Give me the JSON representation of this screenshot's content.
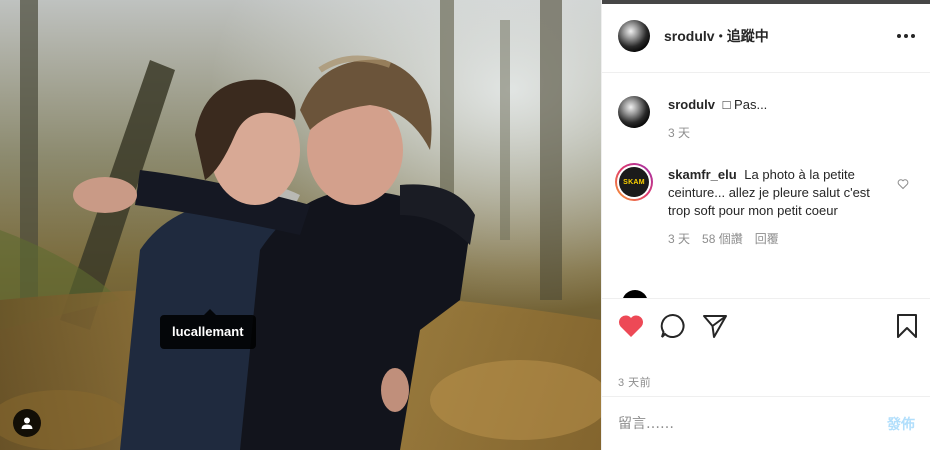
{
  "photo": {
    "tag_label": "lucallemant",
    "user_tag_icon": "user-icon"
  },
  "header": {
    "username": "srodulv",
    "separator": "•",
    "follow_label": "追蹤中",
    "more_icon": "more-options-icon"
  },
  "caption": {
    "username": "srodulv",
    "text": "□ Pas...",
    "time": "3 天"
  },
  "comments": [
    {
      "username": "skamfr_elu",
      "avatar_text": "SKAM",
      "text": "La photo à la petite ceinture... allez je pleure salut c'est trop soft pour mon petit coeur",
      "time": "3 天",
      "likes": "58 個讚",
      "reply_label": "回覆"
    }
  ],
  "actions": {
    "like_icon": "heart-filled-icon",
    "comment_icon": "comment-icon",
    "share_icon": "share-icon",
    "save_icon": "bookmark-icon",
    "like_color": "#ed4956"
  },
  "post_date": "3 天前",
  "comment_box": {
    "placeholder": "留言……",
    "post_label": "發佈",
    "post_color": "#b2dffc"
  }
}
